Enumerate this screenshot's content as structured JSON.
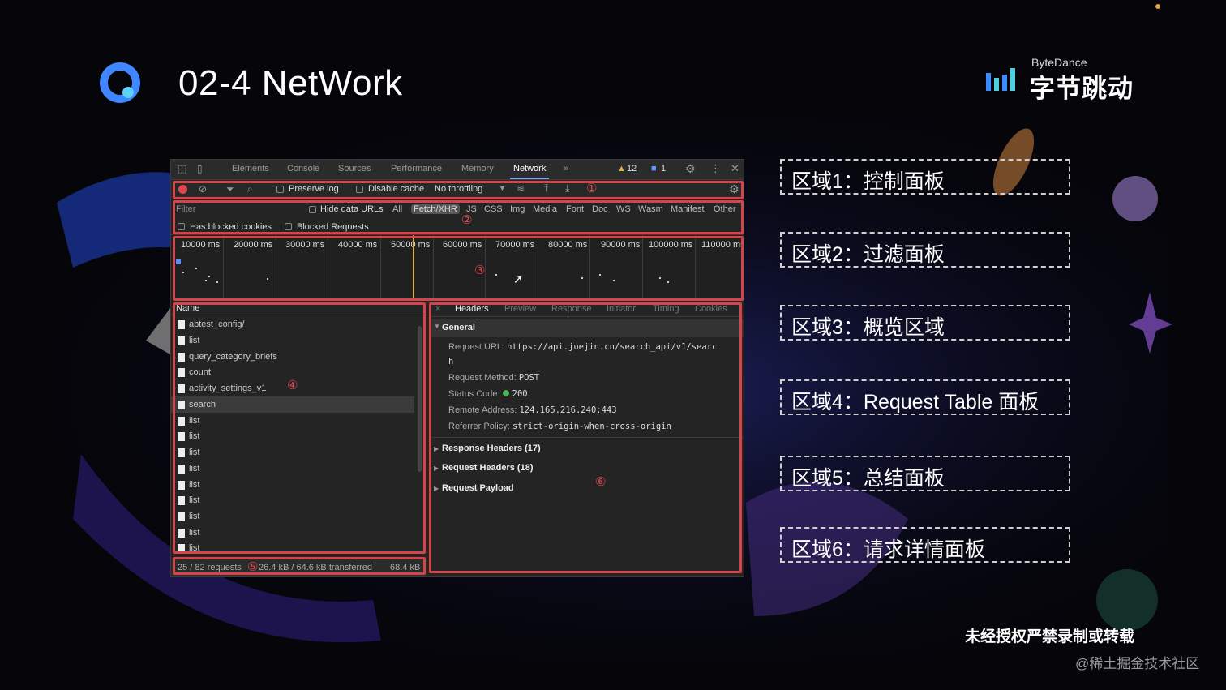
{
  "slide": {
    "title": "02-4 NetWork",
    "brand_en": "ByteDance",
    "brand_cn": "字节跳动",
    "copyright": "未经授权严禁录制或转载",
    "watermark": "@稀土掘金技术社区"
  },
  "legend": [
    "区域1：控制面板",
    "区域2：过滤面板",
    "区域3：概览区域",
    "区域4：Request Table 面板",
    "区域5：总结面板",
    "区域6：请求详情面板"
  ],
  "region_numbers": [
    "①",
    "②",
    "③",
    "④",
    "⑤",
    "⑥"
  ],
  "devtools": {
    "tabs": [
      "Elements",
      "Console",
      "Sources",
      "Performance",
      "Memory",
      "Network",
      "»"
    ],
    "active_tab": "Network",
    "warnings_badge": "12",
    "messages_badge": "1",
    "toolbar": {
      "preserve_log": "Preserve log",
      "disable_cache": "Disable cache",
      "throttling": "No throttling"
    },
    "filter": {
      "placeholder": "Filter",
      "hide_data_urls": "Hide data URLs",
      "types": [
        "All",
        "Fetch/XHR",
        "JS",
        "CSS",
        "Img",
        "Media",
        "Font",
        "Doc",
        "WS",
        "Wasm",
        "Manifest",
        "Other"
      ],
      "selected_type": "Fetch/XHR",
      "has_blocked_cookies": "Has blocked cookies",
      "blocked_requests": "Blocked Requests"
    },
    "overview_ticks": [
      "10000 ms",
      "20000 ms",
      "30000 ms",
      "40000 ms",
      "50000 ms",
      "60000 ms",
      "70000 ms",
      "80000 ms",
      "90000 ms",
      "100000 ms",
      "110000 ms"
    ],
    "request_table": {
      "header": "Name",
      "rows": [
        "abtest_config/",
        "list",
        "query_category_briefs",
        "count",
        "activity_settings_v1",
        "search",
        "list",
        "list",
        "list",
        "list",
        "list",
        "list",
        "list",
        "list",
        "list"
      ],
      "selected": "search"
    },
    "summary": {
      "requests": "25 / 82 requests",
      "transferred": "26.4 kB / 64.6 kB transferred",
      "resources": "68.4 kB"
    },
    "details": {
      "close": "×",
      "tabs": [
        "Headers",
        "Preview",
        "Response",
        "Initiator",
        "Timing",
        "Cookies"
      ],
      "active_tab": "Headers",
      "general_title": "General",
      "request_url_label": "Request URL:",
      "request_url_value": "https://api.juejin.cn/search_api/v1/searc",
      "request_url_wrap": "h",
      "method_label": "Request Method:",
      "method_value": "POST",
      "status_label": "Status Code:",
      "status_value": "200",
      "remote_label": "Remote Address:",
      "remote_value": "124.165.216.240:443",
      "referrer_label": "Referrer Policy:",
      "referrer_value": "strict-origin-when-cross-origin",
      "response_headers": "Response Headers (17)",
      "request_headers": "Request Headers (18)",
      "request_payload": "Request Payload"
    }
  }
}
